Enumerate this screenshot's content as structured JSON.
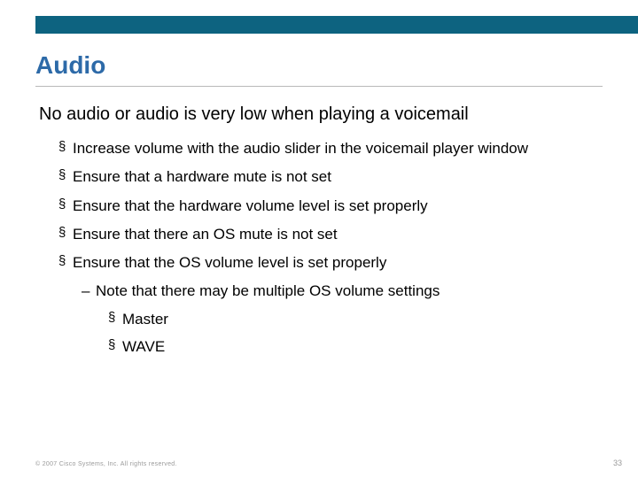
{
  "title": "Audio",
  "subhead": "No audio or audio is very low when playing a voicemail",
  "bullets": [
    "Increase volume with the audio slider in the voicemail player window",
    "Ensure that a hardware mute is not set",
    "Ensure that the hardware volume level is set properly",
    "Ensure that there an OS mute is not set",
    "Ensure that the OS volume level is set properly"
  ],
  "sub_note": "Note that there may be multiple OS volume settings",
  "sub_items": [
    "Master",
    "WAVE"
  ],
  "footer_left": "© 2007 Cisco Systems, Inc. All rights reserved.",
  "footer_right": "33"
}
